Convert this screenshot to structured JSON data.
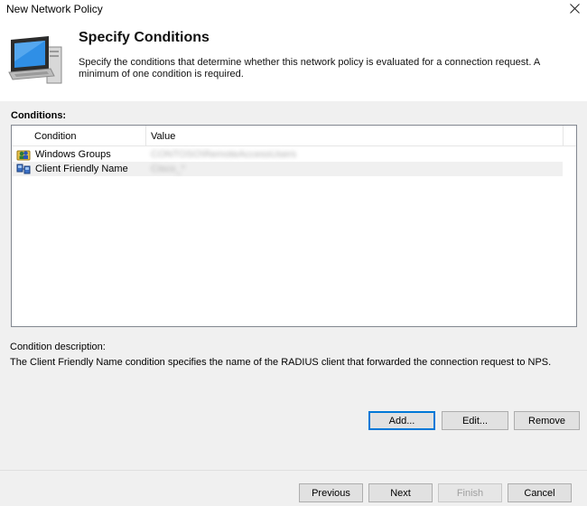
{
  "window": {
    "title": "New Network Policy"
  },
  "header": {
    "title": "Specify Conditions",
    "description": "Specify the conditions that determine whether this network policy is evaluated for a connection request. A minimum of one condition is required."
  },
  "conditions": {
    "label": "Conditions:",
    "columns": [
      "Condition",
      "Value"
    ],
    "rows": [
      {
        "condition": "Windows Groups",
        "value": "CONTOSO\\RemoteAccessUsers"
      },
      {
        "condition": "Client Friendly Name",
        "value": "Cisco_*"
      }
    ]
  },
  "description": {
    "label": "Condition description:",
    "text": "The Client Friendly Name condition specifies the name of the RADIUS client that forwarded the connection request to NPS."
  },
  "buttons": {
    "add": "Add...",
    "edit": "Edit...",
    "remove": "Remove",
    "previous": "Previous",
    "next": "Next",
    "finish": "Finish",
    "cancel": "Cancel"
  }
}
